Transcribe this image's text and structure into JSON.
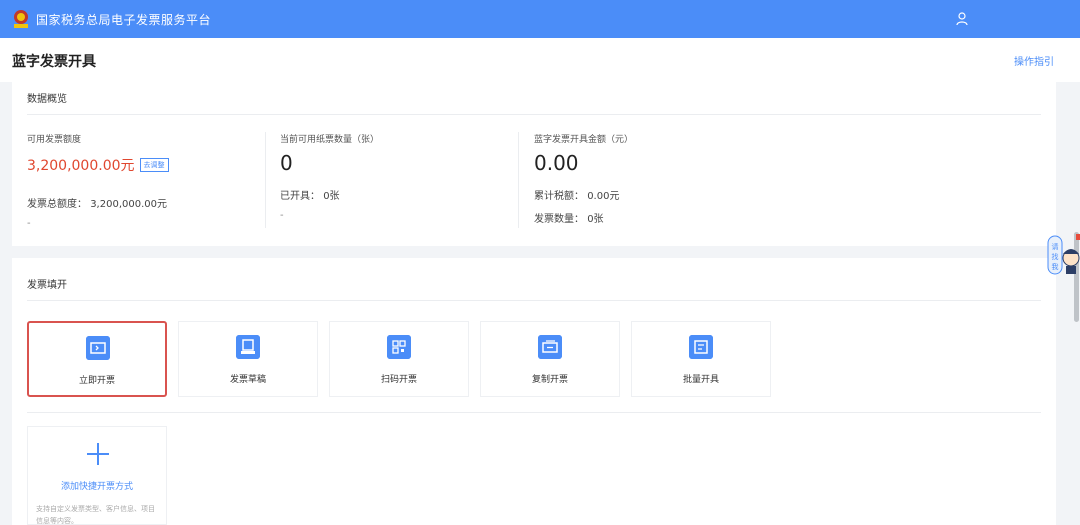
{
  "header": {
    "app_title": "国家税务总局电子发票服务平台",
    "logo_icon": "tax-emblem-icon",
    "user_icon": "user-icon",
    "color": "#4b8df8"
  },
  "page": {
    "title": "蓝字发票开具",
    "guide_link": "操作指引"
  },
  "overview": {
    "section_title": "数据概览",
    "available_quota": {
      "label": "可用发票额度",
      "value": "3,200,000.00元",
      "adjust_button": "去调整",
      "total_label": "发票总额度：",
      "total_value": "3,200,000.00元",
      "dash": "-"
    },
    "paper_invoices": {
      "label": "当前可用纸票数量（张）",
      "value": "0",
      "issued_label": "已开具：",
      "issued_value": "0张",
      "dash": "-"
    },
    "blue_invoice_amount": {
      "label": "蓝字发票开具金额（元）",
      "value": "0.00",
      "tax_label": "累计税额：",
      "tax_value": "0.00元",
      "count_label": "发票数量：",
      "count_value": "0张"
    }
  },
  "fill": {
    "section_title": "发票填开",
    "buttons": [
      {
        "label": "立即开票",
        "icon": "ticket-icon"
      },
      {
        "label": "发票草稿",
        "icon": "draft-icon"
      },
      {
        "label": "扫码开票",
        "icon": "qrcode-icon"
      },
      {
        "label": "复制开票",
        "icon": "copy-ticket-icon"
      },
      {
        "label": "批量开具",
        "icon": "batch-ticket-icon"
      }
    ],
    "add_shortcut": {
      "label": "添加快捷开票方式",
      "description": "支持自定义发票类型、客户信息、项目信息等内容。"
    }
  },
  "assistant": {
    "text": "有问题请找我",
    "icon": "assistant-avatar-icon"
  },
  "colors": {
    "accent": "#4b8df8",
    "amount_red": "#e0472f",
    "active_border": "#d9534f"
  }
}
